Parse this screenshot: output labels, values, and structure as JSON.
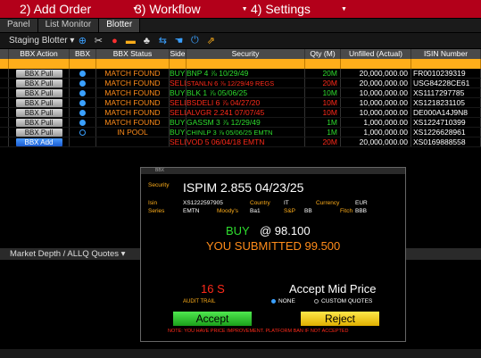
{
  "menubar": {
    "items": [
      "2) Add Order",
      "3) Workflow",
      "4) Settings"
    ]
  },
  "tabs": [
    "Panel",
    "List Monitor",
    "Blotter"
  ],
  "toolbar": {
    "staging_label": "Staging Blotter ▾"
  },
  "grid": {
    "headers": [
      "BBX Action",
      "BBX",
      "BBX Status",
      "Side",
      "Security",
      "Qty (M)",
      "Unfilled (Actual)",
      "ISIN Number"
    ],
    "rows": [
      {
        "action": "BBX Pull",
        "dot": "filled",
        "status": "MATCH FOUND",
        "side": "BUY",
        "security": "BNP 4 ⅞ 10/29/49",
        "qty": "20M",
        "unfilled": "20,000,000.00",
        "isin": "FR0010239319"
      },
      {
        "action": "BBX Pull",
        "dot": "filled",
        "status": "MATCH FOUND",
        "side": "SELL",
        "security": "STANLN 6 ⅞ 12/29/49 REGS",
        "qty": "20M",
        "unfilled": "20,000,000.00",
        "isin": "USG84228CE61"
      },
      {
        "action": "BBX Pull",
        "dot": "filled",
        "status": "MATCH FOUND",
        "side": "BUY",
        "security": "BLK 1 ⅞ 05/06/25",
        "qty": "10M",
        "unfilled": "10,000,000.00",
        "isin": "XS1117297785"
      },
      {
        "action": "BBX Pull",
        "dot": "filled",
        "status": "MATCH FOUND",
        "side": "SELL",
        "security": "BSDELI 6 ⅞ 04/27/20",
        "qty": "10M",
        "unfilled": "10,000,000.00",
        "isin": "XS1218231105"
      },
      {
        "action": "BBX Pull",
        "dot": "filled",
        "status": "MATCH FOUND",
        "side": "SELL",
        "security": "ALVGR 2.241 07/07/45",
        "qty": "10M",
        "unfilled": "10,000,000.00",
        "isin": "DE000A14J9N8"
      },
      {
        "action": "BBX Pull",
        "dot": "filled",
        "status": "MATCH FOUND",
        "side": "BUY",
        "security": "GASSM 3 ⅞ 12/29/49",
        "qty": "1M",
        "unfilled": "1,000,000.00",
        "isin": "XS1224710399"
      },
      {
        "action": "BBX Pull",
        "dot": "hollow",
        "status": "IN POOL",
        "side": "BUY",
        "security": "CHINLP 3 ⅞ 05/06/25 EMTN",
        "qty": "1M",
        "unfilled": "1,000,000.00",
        "isin": "XS1226628961"
      },
      {
        "action": "BBX Add",
        "dot": "none",
        "status": "",
        "side": "SELL",
        "security": "VOD 5 06/04/18 EMTN",
        "qty": "20M",
        "unfilled": "20,000,000.00",
        "isin": "XS0169888558"
      }
    ]
  },
  "market_depth": {
    "label": "Market Depth / ALLQ Quotes ▾"
  },
  "dialog": {
    "title": "BBX",
    "security_label": "Security",
    "security_name": "ISPIM 2.855 04/23/25",
    "isin_label": "Isin",
    "isin_value": "XS1222597905",
    "country_label": "Country",
    "country_value": "IT",
    "currency_label": "Currency",
    "currency_value": "EUR",
    "series_label": "Series",
    "series_value": "EMTN",
    "moodys_label": "Moody's",
    "moodys_value": "Ba1",
    "sp_label": "S&P",
    "sp_value": "BB",
    "fitch_label": "Fitch",
    "fitch_value": "BBB",
    "side": "BUY",
    "price_line": "@ 98.100",
    "submitted_line": "YOU SUBMITTED 99.500",
    "spread": "16 S",
    "audit_label": "AUDIT TRAIL",
    "accept_mid_label": "Accept Mid Price",
    "radio_none": "NONE",
    "radio_custom": "CUSTOM QUOTES",
    "accept_label": "Accept",
    "reject_label": "Reject",
    "note": "NOTE: YOU HAVE PRICE IMPROVEMENT. PLATFORM BAN IF NOT ACCEPTED"
  }
}
